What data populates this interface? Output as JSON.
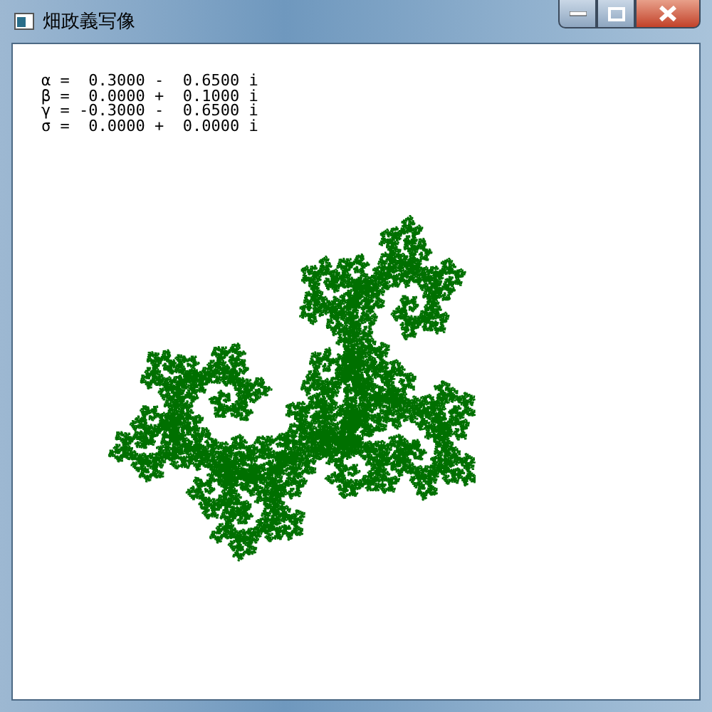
{
  "window": {
    "title": "畑政義写像"
  },
  "parameters": [
    {
      "text": "α =  0.3000 -  0.6500 i"
    },
    {
      "text": "β =  0.0000 +  0.1000 i"
    },
    {
      "text": "γ = -0.3000 -  0.6500 i"
    },
    {
      "text": "σ =  0.0000 +  0.0000 i"
    }
  ]
}
